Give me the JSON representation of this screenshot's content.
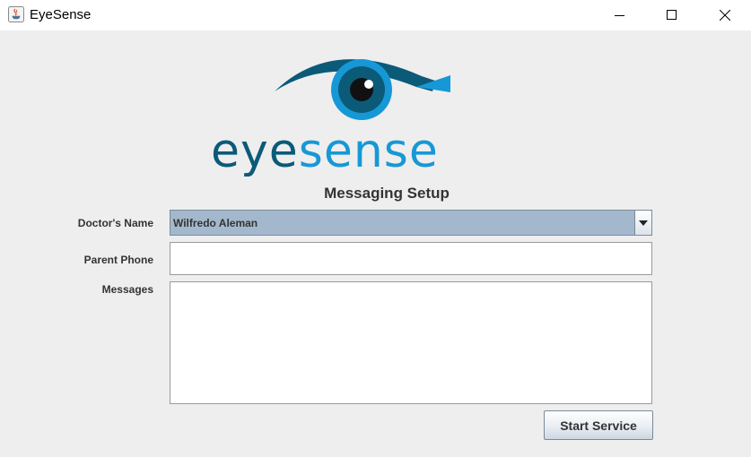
{
  "window": {
    "title": "EyeSense",
    "controls": [
      "minimize",
      "maximize",
      "close"
    ]
  },
  "logo": {
    "text_dark": "eye",
    "text_light": "sense",
    "colors": {
      "dark": "#0b5a78",
      "light": "#1798d6"
    }
  },
  "form": {
    "heading": "Messaging Setup",
    "doctor_label": "Doctor's Name",
    "doctor_selected": "Wilfredo Aleman",
    "phone_label": "Parent Phone",
    "phone_value": "",
    "messages_label": "Messages",
    "messages_value": "",
    "start_label": "Start Service"
  }
}
